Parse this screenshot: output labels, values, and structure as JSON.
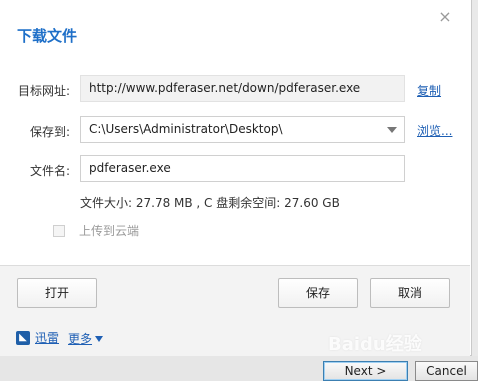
{
  "dialog": {
    "title": "下载文件",
    "close_symbol": "×"
  },
  "form": {
    "url_label": "目标网址:",
    "url_value": "http://www.pdferaser.net/down/pdferaser.exe",
    "copy_link": "复制",
    "save_to_label": "保存到:",
    "save_to_value": "C:\\Users\\Administrator\\Desktop\\",
    "browse_link": "浏览...",
    "filename_label": "文件名:",
    "filename_value": "pdferaser.exe",
    "file_info": "文件大小: 27.78 MB , C 盘剩余空间: 27.60 GB",
    "upload_cloud_label": "上传到云端",
    "upload_cloud_checked": false
  },
  "footer": {
    "open_button": "打开",
    "save_button": "保存",
    "cancel_button": "取消",
    "brand_label": "迅雷",
    "more_label": "更多"
  },
  "watermark": "Baidu经验",
  "wizard": {
    "next_button": "Next >",
    "cancel_button": "Cancel"
  },
  "colors": {
    "title": "#1e6fc8",
    "link": "#1e5fb4",
    "brand": "#1f5fa8"
  },
  "icons": {
    "close": "close-icon",
    "dropdown": "chevron-down-icon",
    "brand": "xunlei-logo-icon",
    "more": "caret-down-icon"
  }
}
